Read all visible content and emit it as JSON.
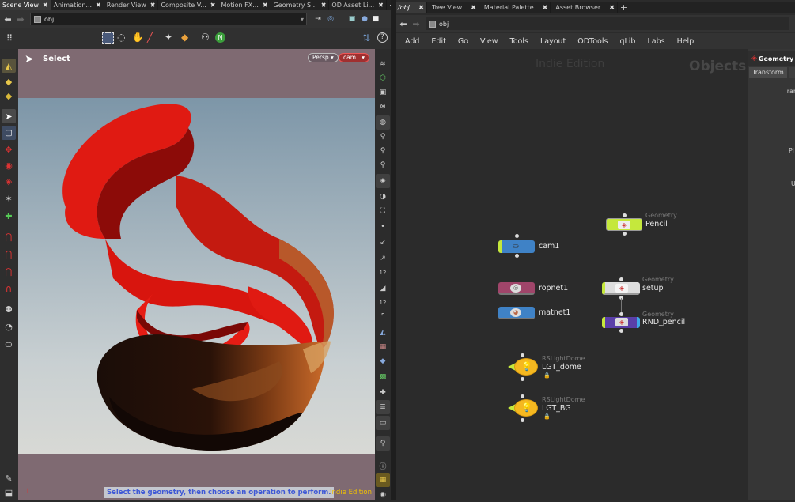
{
  "left_tabs": [
    {
      "label": "Scene View"
    },
    {
      "label": "Animation..."
    },
    {
      "label": "Render View"
    },
    {
      "label": "Composite V..."
    },
    {
      "label": "Motion FX..."
    },
    {
      "label": "Geometry S..."
    },
    {
      "label": "OD Asset Li..."
    }
  ],
  "right_tabs": [
    {
      "label": "/obj"
    },
    {
      "label": "Tree View"
    },
    {
      "label": "Material Palette"
    },
    {
      "label": "Asset Browser"
    }
  ],
  "viewport": {
    "path": "obj",
    "mode_label": "Select",
    "persp_label": "Persp",
    "cam_label": "cam1",
    "status_text": "Select the geometry, then choose an operation to perform.",
    "edition": "Indie Edition"
  },
  "network": {
    "path": "obj",
    "menu": [
      "Add",
      "Edit",
      "Go",
      "View",
      "Tools",
      "Layout",
      "ODTools",
      "qLib",
      "Labs",
      "Help"
    ],
    "watermark": "Indie Edition",
    "context_label": "Objects",
    "nodes": {
      "pencil": {
        "type": "Geometry",
        "label": "Pencil"
      },
      "cam1": {
        "label": "cam1"
      },
      "ropnet1": {
        "label": "ropnet1"
      },
      "setup": {
        "type": "Geometry",
        "label": "setup"
      },
      "matnet1": {
        "label": "matnet1"
      },
      "rnd_pencil": {
        "type": "Geometry",
        "label": "RND_pencil"
      },
      "lgt_dome": {
        "type": "RSLightDome",
        "label": "LGT_dome"
      },
      "lgt_bg": {
        "type": "RSLightDome",
        "label": "LGT_BG"
      }
    }
  },
  "params": {
    "title": "Geometry",
    "tab_transform": "Transform",
    "row1": "Tran",
    "row2": "Pi",
    "row3": "U"
  },
  "colors": {
    "viewport_top": "#7f6a72",
    "viewport_bg_top": "#7d96a8",
    "viewport_bg_bottom": "#d6d9d6",
    "ribbon_red": "#e01a12",
    "status_bg": "#c4c7cf",
    "status_text": "#3e58d6",
    "edition_text": "#f2c200"
  }
}
